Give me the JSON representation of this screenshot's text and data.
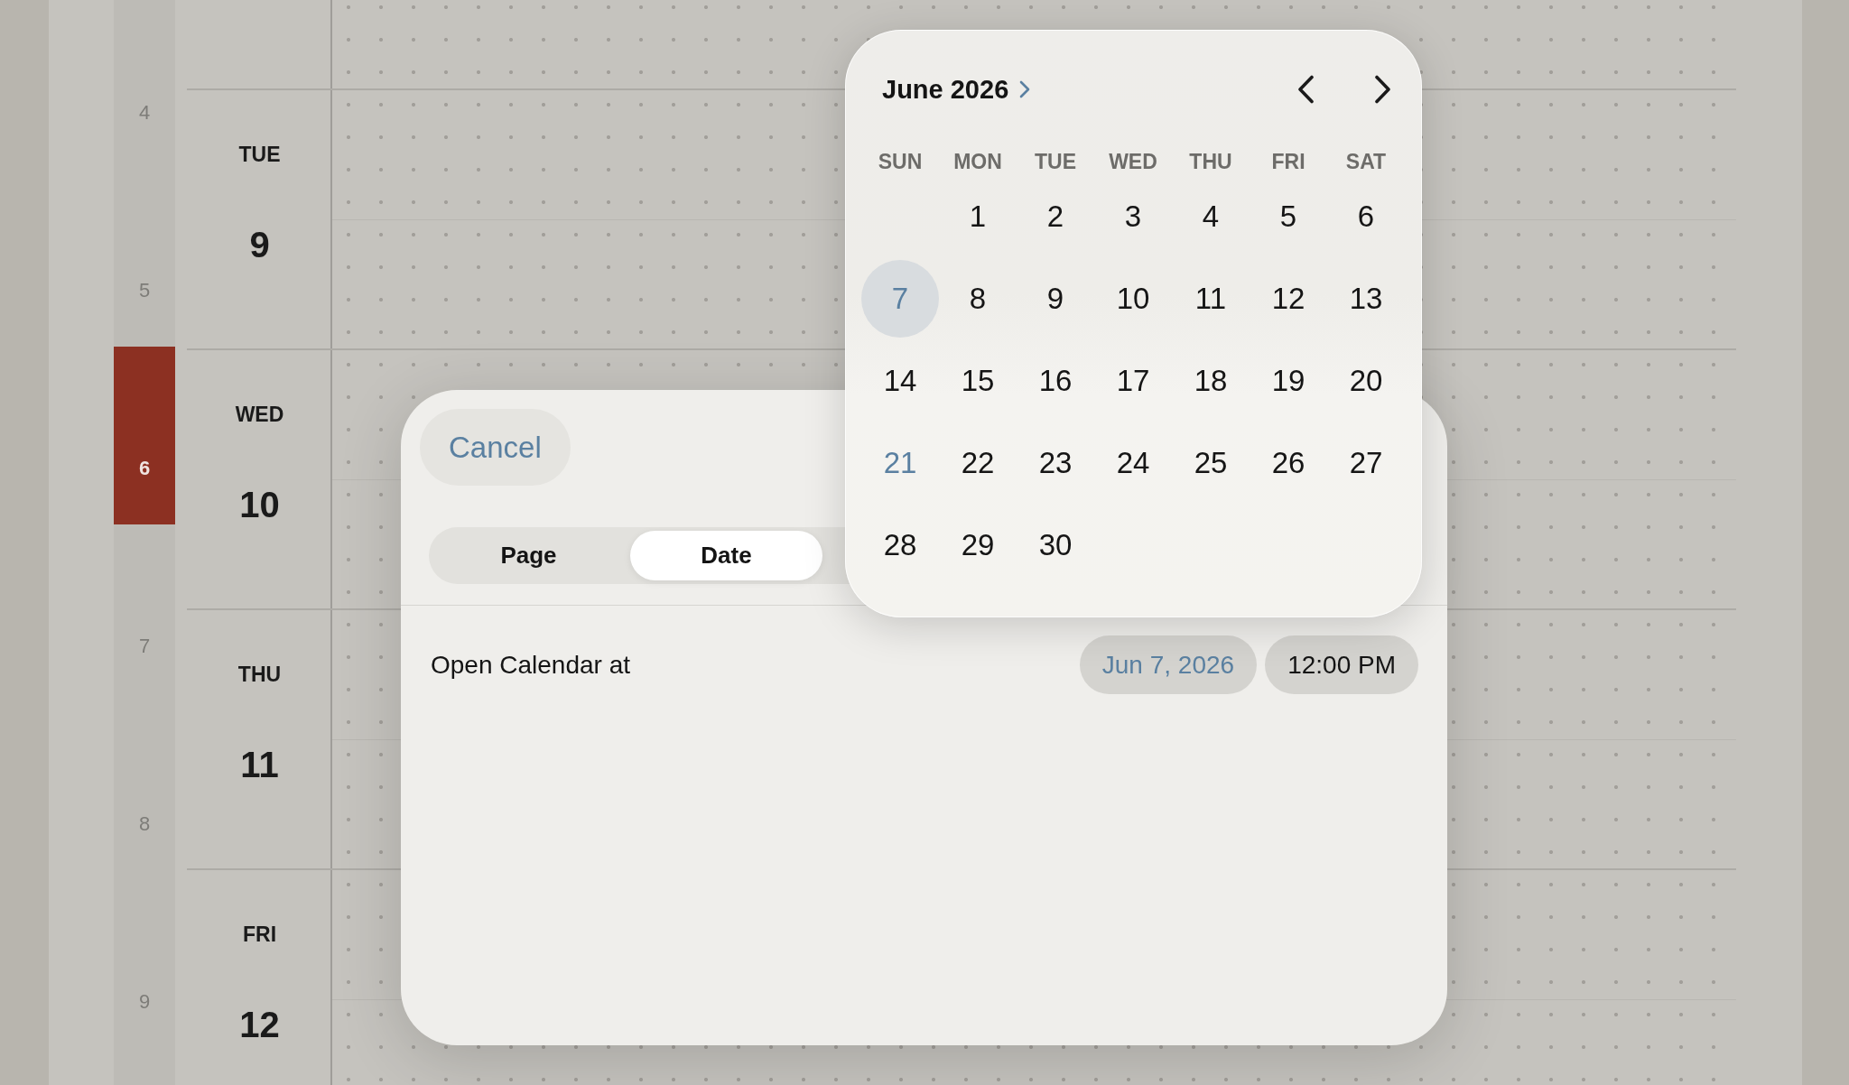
{
  "index_strip": [
    {
      "label": "4",
      "selected": false
    },
    {
      "label": "5",
      "selected": false
    },
    {
      "label": "6",
      "selected": true
    },
    {
      "label": "7",
      "selected": false
    },
    {
      "label": "8",
      "selected": false
    },
    {
      "label": "9",
      "selected": false
    }
  ],
  "days": [
    {
      "weekday": "TUE",
      "date": "9"
    },
    {
      "weekday": "WED",
      "date": "10"
    },
    {
      "weekday": "THU",
      "date": "11"
    },
    {
      "weekday": "FRI",
      "date": "12"
    }
  ],
  "sheet": {
    "cancel_button": "Cancel",
    "segments": [
      {
        "label": "Page",
        "selected": false
      },
      {
        "label": "Date",
        "selected": true
      }
    ],
    "row": {
      "label": "Open Calendar at",
      "date_field": {
        "value": "Jun 7, 2026",
        "expanded": true
      },
      "time_field": {
        "value": "12:00 PM",
        "expanded": false
      }
    }
  },
  "date_picker": {
    "month_title": "June 2026",
    "weekdays": [
      "SUN",
      "MON",
      "TUE",
      "WED",
      "THU",
      "FRI",
      "SAT"
    ],
    "weeks": [
      [
        {
          "day": "1",
          "selected": false,
          "today": false
        },
        {
          "day": "2",
          "selected": false,
          "today": false
        },
        {
          "day": "3",
          "selected": false,
          "today": false
        },
        {
          "day": "4",
          "selected": false,
          "today": false
        },
        {
          "day": "5",
          "selected": false,
          "today": false
        },
        {
          "day": "6",
          "selected": false,
          "today": false
        }
      ],
      [
        {
          "day": "7",
          "selected": true,
          "today": false
        },
        {
          "day": "8",
          "selected": false,
          "today": false
        },
        {
          "day": "9",
          "selected": false,
          "today": false
        },
        {
          "day": "10",
          "selected": false,
          "today": false
        },
        {
          "day": "11",
          "selected": false,
          "today": false
        },
        {
          "day": "12",
          "selected": false,
          "today": false
        },
        {
          "day": "13",
          "selected": false,
          "today": false
        }
      ],
      [
        {
          "day": "14",
          "selected": false,
          "today": false
        },
        {
          "day": "15",
          "selected": false,
          "today": false
        },
        {
          "day": "16",
          "selected": false,
          "today": false
        },
        {
          "day": "17",
          "selected": false,
          "today": false
        },
        {
          "day": "18",
          "selected": false,
          "today": false
        },
        {
          "day": "19",
          "selected": false,
          "today": false
        },
        {
          "day": "20",
          "selected": false,
          "today": false
        }
      ],
      [
        {
          "day": "21",
          "selected": false,
          "today": true
        },
        {
          "day": "22",
          "selected": false,
          "today": false
        },
        {
          "day": "23",
          "selected": false,
          "today": false
        },
        {
          "day": "24",
          "selected": false,
          "today": false
        },
        {
          "day": "25",
          "selected": false,
          "today": false
        },
        {
          "day": "26",
          "selected": false,
          "today": false
        },
        {
          "day": "27",
          "selected": false,
          "today": false
        }
      ],
      [
        {
          "day": "28",
          "selected": false,
          "today": false
        },
        {
          "day": "29",
          "selected": false,
          "today": false
        },
        {
          "day": "30",
          "selected": false,
          "today": false
        }
      ]
    ]
  }
}
